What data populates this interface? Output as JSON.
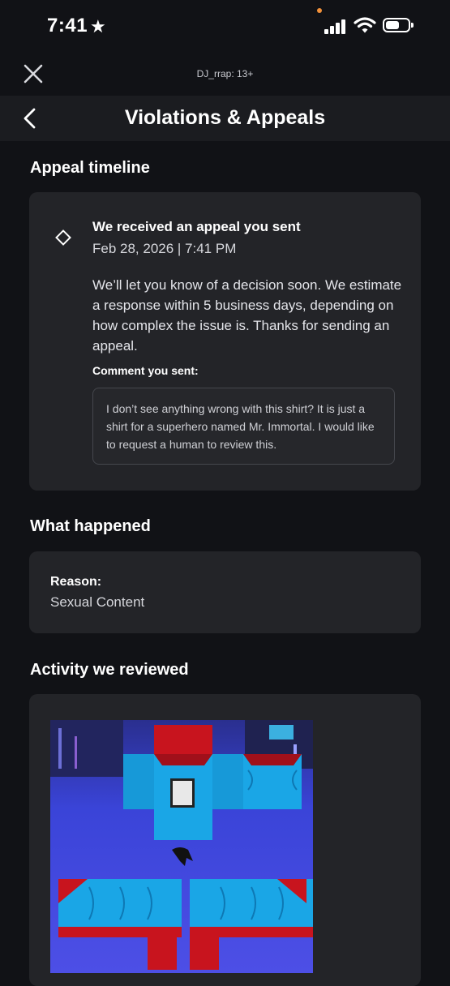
{
  "status_bar": {
    "time": "7:41",
    "star": "★"
  },
  "top_bar": {
    "account_label": "DJ_rrap: 13+"
  },
  "header": {
    "title": "Violations & Appeals"
  },
  "appeal_timeline": {
    "section_title": "Appeal timeline",
    "event": {
      "title": "We received an appeal you sent",
      "date": "Feb 28, 2026 | 7:41 PM",
      "body": "We’ll let you know of a decision soon. We estimate a response within 5 business days, depending on how complex the issue is. Thanks for sending an appeal.",
      "comment_label": "Comment you sent:",
      "comment": "I don’t see anything wrong with this shirt? It is just a shirt for a superhero named Mr. Immortal. I would like to request a human to review this."
    }
  },
  "what_happened": {
    "section_title": "What happened",
    "reason_label": "Reason:",
    "reason_value": "Sexual Content"
  },
  "activity": {
    "section_title": "Activity we reviewed",
    "image": "shirt-template-image"
  },
  "colors": {
    "background": "#111216",
    "card": "#232428",
    "header": "#1b1c20",
    "shirt_red": "#c8141e",
    "shirt_blue": "#1aa6e6",
    "backdrop_blue": "#3a44d8"
  }
}
